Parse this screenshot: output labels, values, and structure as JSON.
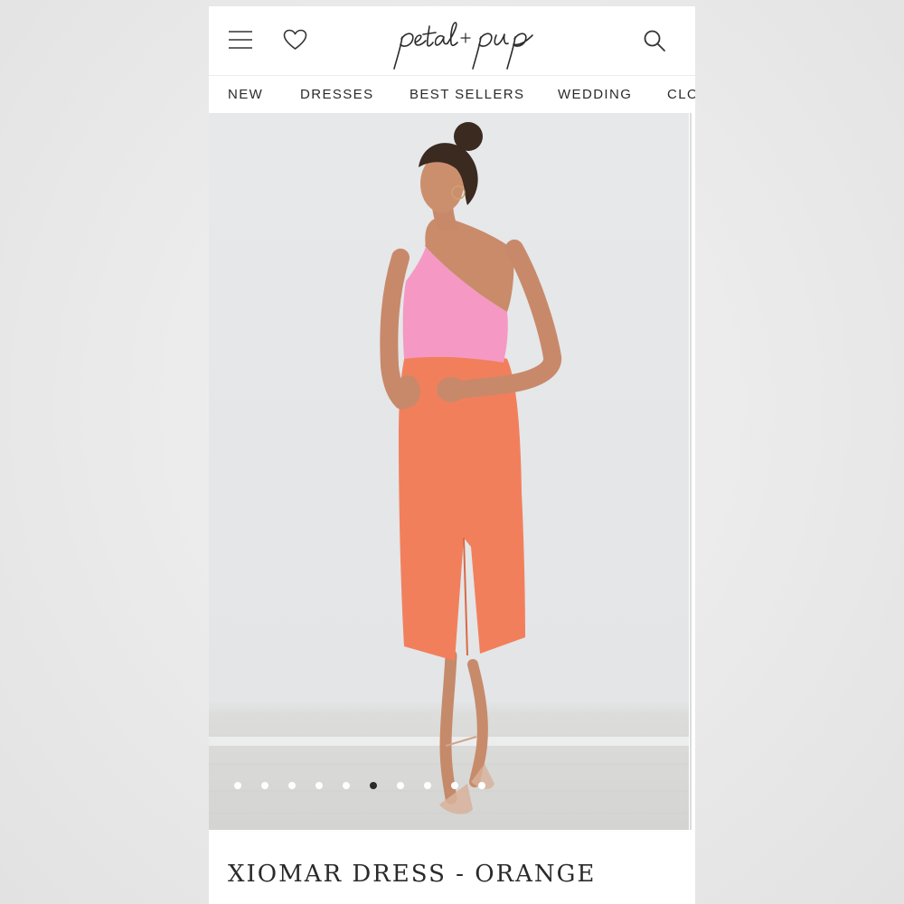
{
  "header": {
    "brand": "petal + pup",
    "icons": [
      "menu-icon",
      "heart-icon",
      "search-icon"
    ]
  },
  "nav": {
    "items": [
      "NEW",
      "DRESSES",
      "BEST SELLERS",
      "WEDDING",
      "CLO"
    ]
  },
  "gallery": {
    "image_count": 10,
    "active_index": 5
  },
  "product": {
    "title": "XIOMAR DRESS - ORANGE"
  },
  "colors": {
    "background": "#ffffff",
    "text": "#2a2a2a",
    "top_pink": "#f598c4",
    "dress_orange": "#f27f5c"
  }
}
